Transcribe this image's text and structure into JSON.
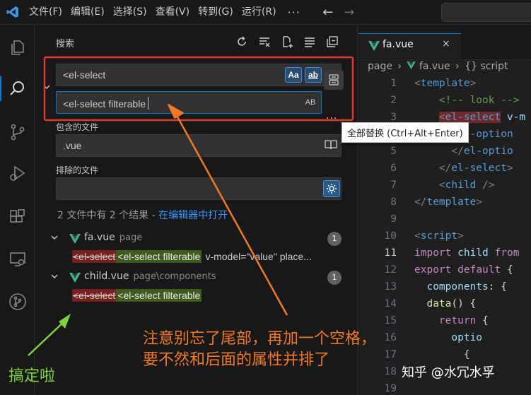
{
  "menu": [
    "文件(F)",
    "编辑(E)",
    "选择(S)",
    "查看(V)",
    "转到(G)",
    "运行(R)"
  ],
  "menu_more": "···",
  "search_panel": {
    "title": "搜索",
    "search_value": "<el-select",
    "replace_value": "<el-select filterable",
    "opt_case": "Aa",
    "opt_word": "ab",
    "opt_regex": ".*",
    "opt_preserve_case": "AB",
    "more": "···",
    "replace_all_tooltip": "全部替换 (Ctrl+Alt+Enter)",
    "include_label": "包含的文件",
    "include_value": ".vue",
    "exclude_label": "排除的文件",
    "exclude_value": "",
    "summary": "2 文件中有 2 个结果 - ",
    "summary_link": "在编辑器中打开"
  },
  "results": [
    {
      "file": "fa.vue",
      "path": "page",
      "count": "1",
      "match_old": "<el-select",
      "match_new": "<el-select filterable",
      "rest": "v-model=\"value\" place..."
    },
    {
      "file": "child.vue",
      "path": "page\\components",
      "count": "1",
      "match_old": "<el-select",
      "match_new": "<el-select filterable",
      "rest": ""
    }
  ],
  "editor": {
    "tab_name": "fa.vue",
    "tab_close": "×",
    "breadcrumb": [
      "page",
      "fa.vue",
      "{} script"
    ],
    "current_line": "11",
    "lines": [
      "1",
      "2",
      "3",
      "4",
      "5",
      "6",
      "7",
      "8",
      "9",
      "10",
      "11",
      "12",
      "13",
      "14",
      "15",
      "16",
      "17",
      "18",
      "19"
    ]
  },
  "annotations": {
    "note_line1": "注意别忘了尾部，再加一个空格，",
    "note_line2": "要不然和后面的属性并排了",
    "done": "搞定啦",
    "watermark": "知乎 @水冗水孚"
  },
  "colors": {
    "accent": "#0078d4",
    "highlight_box": "#e03b2c",
    "annotation_orange": "#f07a28",
    "annotation_green": "#7fd43b",
    "vue_green": "#41b883"
  }
}
